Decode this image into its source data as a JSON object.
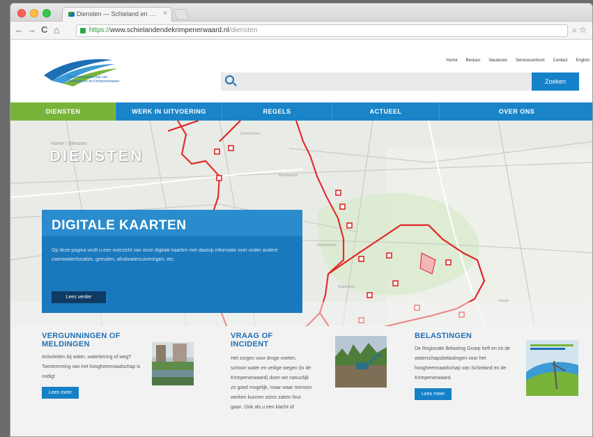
{
  "browser": {
    "tab_title": "Diensten — Schieland en …",
    "url_scheme": "https://",
    "url_host": "www.schielandendekrimpenerwaard.nl",
    "url_path": "/diensten",
    "back": "←",
    "forward": "→",
    "reload": "C",
    "home": "⌂",
    "zoom": "⌕",
    "star": "☆",
    "tab_close": "×"
  },
  "header": {
    "logo_text_line1": "Hoogheemraadschap van",
    "logo_text_line2": "Schieland en de Krimpenerwaard",
    "toplinks": [
      "Home",
      "Bestuur",
      "Vacatures",
      "Servicecentrum",
      "Contact",
      "English"
    ],
    "search_placeholder": "",
    "search_button": "Zoeken"
  },
  "nav": {
    "items": [
      "DIENSTEN",
      "WERK IN UITVOERING",
      "REGELS",
      "ACTUEEL",
      "OVER ONS"
    ],
    "active": 0
  },
  "hero": {
    "breadcrumb": "Home / Diensten",
    "title": "DIENSTEN"
  },
  "panel": {
    "title": "DIGITALE KAARTEN",
    "text": "Op deze pagina vindt u een overzicht van onze digitale kaarten met daarop informatie over onder andere zwemwaterlocaties, gemalen, afvalwaterzuiveringen, etc.",
    "button": "Lees verder"
  },
  "cards": [
    {
      "title": "VERGUNNINGEN OF MELDINGEN",
      "text": "Activiteiten bij water, waterkering of weg? Toestemming van het hoogheemraadschap is nodig!",
      "button": "Lees meer"
    },
    {
      "title": "VRAAG OF INCIDENT",
      "text": "Het zorgen voor droge voeten, schoon water en veilige wegen (in de Krimpenerwaard) doen we natuurlijk zo goed mogelijk, maar waar mensen werken kunnen soms zaken fout gaan. Ook als u een klacht of"
    },
    {
      "title": "BELASTINGEN",
      "text": "De Regionale Belasting Groep heft en int de waterschapsbelastingen voor het hoogheemraadschap van Schieland en de Krimpenerwaard.",
      "button": "Lees meer"
    }
  ],
  "colors": {
    "primary_blue": "#1a84c8",
    "active_green": "#79b43a",
    "boundary_red": "#e02424",
    "panel_blue": "#1a78bd"
  }
}
